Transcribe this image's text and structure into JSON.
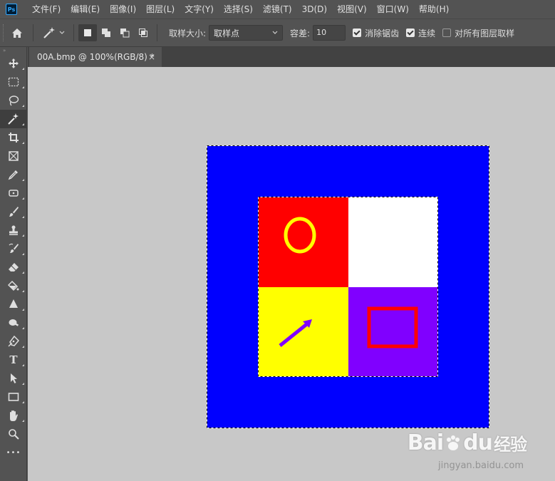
{
  "app": {
    "logo_text": "Ps"
  },
  "menu": [
    "文件(F)",
    "编辑(E)",
    "图像(I)",
    "图层(L)",
    "文字(Y)",
    "选择(S)",
    "滤镜(T)",
    "3D(D)",
    "视图(V)",
    "窗口(W)",
    "帮助(H)"
  ],
  "options": {
    "sample_size_label": "取样大小:",
    "sample_size_value": "取样点",
    "tolerance_label": "容差:",
    "tolerance_value": "10",
    "anti_alias_label": "消除锯齿",
    "anti_alias_checked": true,
    "contiguous_label": "连续",
    "contiguous_checked": true,
    "sample_all_layers_label": "对所有图层取样",
    "sample_all_layers_checked": false
  },
  "document": {
    "tab_title": "00A.bmp @ 100%(RGB/8) *",
    "close_glyph": "×"
  },
  "toolbar": {
    "collapse_glyph": "»",
    "type_tool_glyph": "T",
    "more_glyph": "•••"
  },
  "image_colors": {
    "outer": "#0000ff",
    "red": "#ff0000",
    "white": "#ffffff",
    "yellow": "#ffff00",
    "purple": "#8000ff",
    "circle": "#ffff00",
    "arrow": "#8000ff",
    "rect": "#ff0000"
  },
  "watermark": {
    "logo_bai": "Bai",
    "logo_du": "du",
    "logo_cn": "经验",
    "url": "jingyan.baidu.com"
  }
}
